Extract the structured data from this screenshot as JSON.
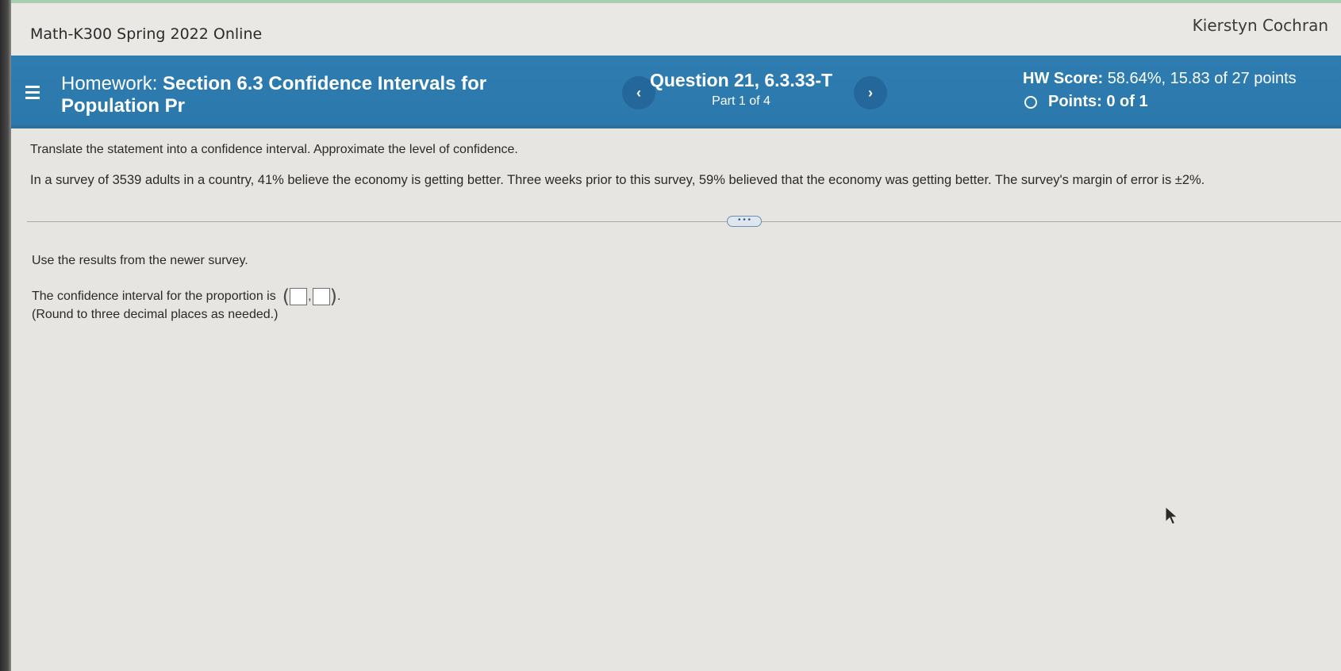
{
  "header": {
    "course": "Math-K300 Spring 2022 Online",
    "user": "Kierstyn Cochran"
  },
  "homework": {
    "label": "Homework:",
    "title": "Section 6.3 Confidence Intervals for Population Pr",
    "menu_icon": "hamburger-menu-icon"
  },
  "question": {
    "title": "Question 21, 6.3.33-T",
    "part": "Part 1 of 4",
    "prev_icon": "‹",
    "next_icon": "›"
  },
  "score": {
    "hw_label": "HW Score:",
    "hw_value": "58.64%, 15.83 of 27 points",
    "points_label": "Points:",
    "points_value": "0 of 1"
  },
  "problem": {
    "instruction": "Translate the statement into a confidence interval. Approximate the level of confidence.",
    "statement": "In a survey of 3539 adults in a country, 41% believe the economy is getting better. Three weeks prior to this survey, 59% believed that the economy was getting better. The survey's margin of error is ±2%.",
    "expand_label": "• • •"
  },
  "part": {
    "instruction": "Use the results from the newer survey.",
    "answer_prefix": "The confidence interval for the proportion is",
    "open_paren": "(",
    "comma": ",",
    "close_paren": ")",
    "period": ".",
    "round_note": "(Round to three decimal places as needed.)"
  },
  "colors": {
    "header_bar": "#2f7db0",
    "nav_button": "#24679a",
    "top_accent": "#a9cdb0"
  }
}
